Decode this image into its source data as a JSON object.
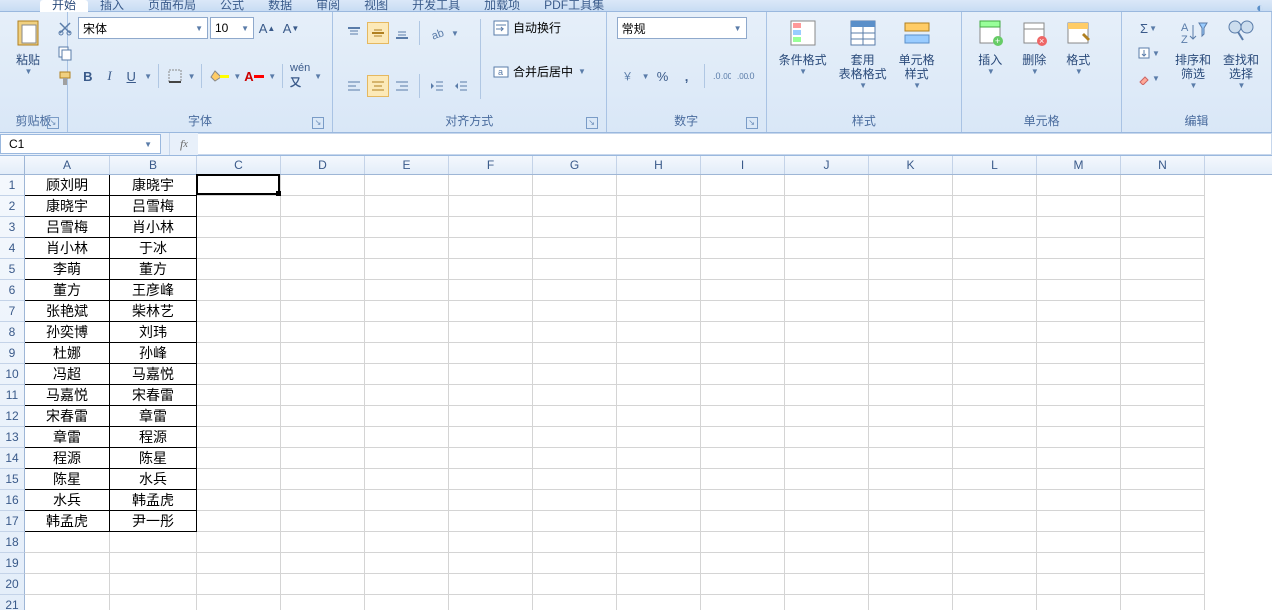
{
  "tabs": {
    "items": [
      "开始",
      "插入",
      "页面布局",
      "公式",
      "数据",
      "审阅",
      "视图",
      "开发工具",
      "加载项",
      "PDF工具集"
    ],
    "active": 0
  },
  "ribbon": {
    "clipboard": {
      "paste": "粘贴",
      "label": "剪贴板"
    },
    "font": {
      "name": "宋体",
      "size": "10",
      "label": "字体",
      "bold": "B",
      "italic": "I",
      "underline": "U"
    },
    "align": {
      "label": "对齐方式",
      "wrap": "自动换行",
      "merge": "合并后居中"
    },
    "number": {
      "label": "数字",
      "format": "常规",
      "percent": "%"
    },
    "styles": {
      "label": "样式",
      "conditional": "条件格式",
      "tablestyle": "套用\n表格格式",
      "cellstyle": "单元格\n样式"
    },
    "cells": {
      "label": "单元格",
      "insert": "插入",
      "delete": "删除",
      "format": "格式"
    },
    "editing": {
      "label": "编辑",
      "sort": "排序和\n筛选",
      "find": "查找和\n选择"
    }
  },
  "namebox": "C1",
  "formula": "",
  "columns": [
    "A",
    "B",
    "C",
    "D",
    "E",
    "F",
    "G",
    "H",
    "I",
    "J",
    "K",
    "L",
    "M",
    "N"
  ],
  "colAData": [
    "顾刘明",
    "康晓宇",
    "吕雪梅",
    "肖小林",
    "李萌",
    "董方",
    "张艳斌",
    "孙奕博",
    "杜娜",
    "冯超",
    "马嘉悦",
    "宋春雷",
    "章雷",
    "程源",
    "陈星",
    "水兵",
    "韩孟虎"
  ],
  "colBData": [
    "康晓宇",
    "吕雪梅",
    "肖小林",
    "于冰",
    "董方",
    "王彦峰",
    "柴林艺",
    "刘玮",
    "孙峰",
    "马嘉悦",
    "宋春雷",
    "章雷",
    "程源",
    "陈星",
    "水兵",
    "韩孟虎",
    "尹一彤"
  ]
}
